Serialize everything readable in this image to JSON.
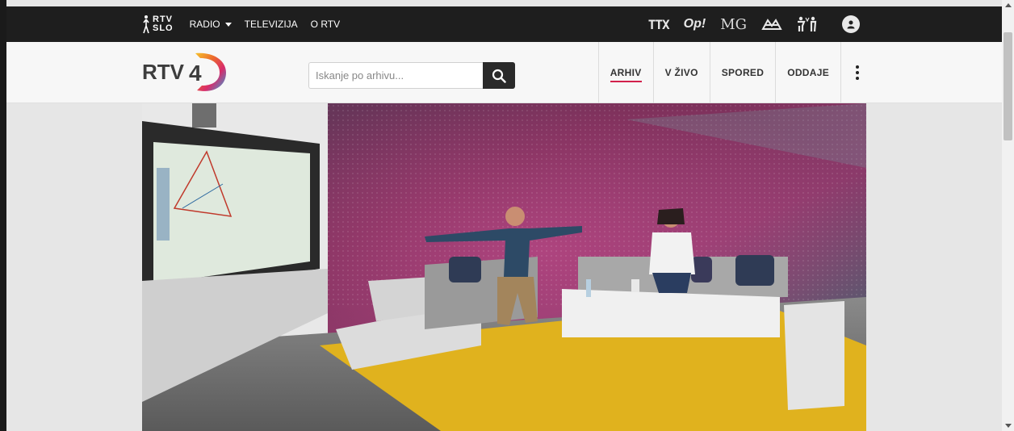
{
  "topbar": {
    "logo_text_top": "RTV",
    "logo_text_bottom": "SLO",
    "nav": [
      {
        "label": "RADIO",
        "dropdown": true
      },
      {
        "label": "TELEVIZIJA"
      },
      {
        "label": "O RTV"
      }
    ],
    "brands": [
      {
        "label": "TTX",
        "icon": "teletext-icon"
      },
      {
        "label": "Op!",
        "icon": "opl-icon"
      },
      {
        "label": "MG",
        "icon": "mg-icon"
      },
      {
        "label": "",
        "icon": "archive-icon"
      },
      {
        "label": "",
        "icon": "accessibility-icon"
      }
    ],
    "user_icon": "user-icon"
  },
  "header": {
    "logo_word": "RTV",
    "logo_number": "4",
    "search": {
      "placeholder": "Iskanje po arhivu...",
      "icon": "search-icon"
    },
    "menu": [
      {
        "label": "ARHIV",
        "active": true
      },
      {
        "label": "V ŽIVO",
        "active": false
      },
      {
        "label": "SPORED",
        "active": false
      },
      {
        "label": "ODDAJE",
        "active": false
      }
    ],
    "more_icon": "more-vertical-icon"
  },
  "colors": {
    "topbar_bg": "#1e1e1e",
    "accent": "#d2214c",
    "header_bg": "#f7f7f7",
    "floor_yellow": "#e0b21e"
  }
}
